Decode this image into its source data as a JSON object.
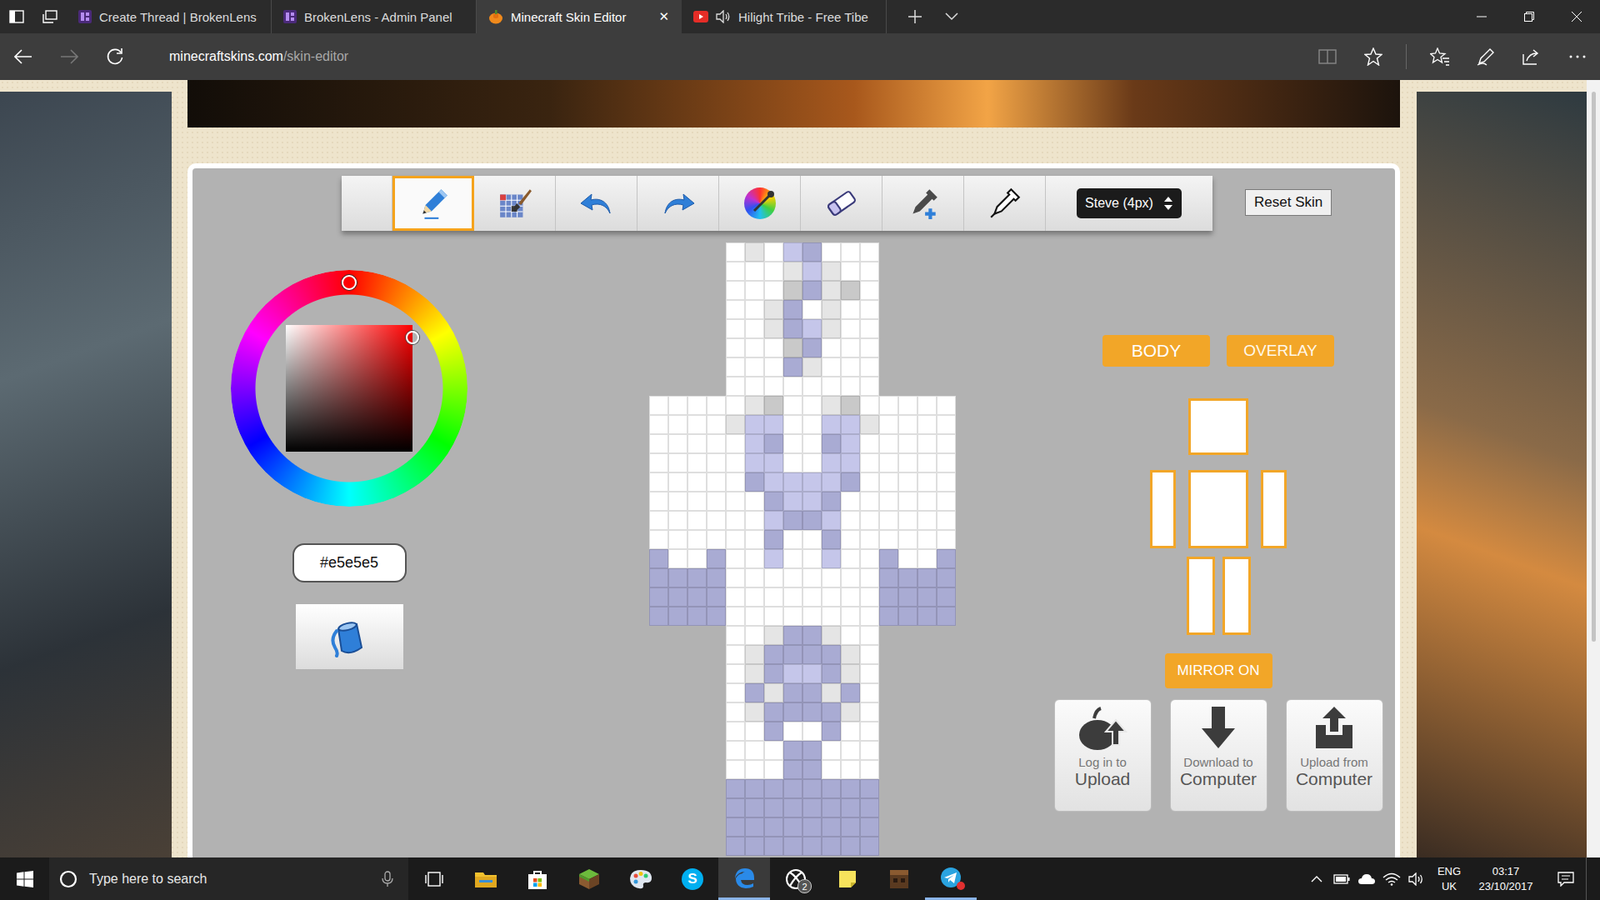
{
  "browser": {
    "tabs": [
      {
        "label": "Create Thread | BrokenLens",
        "selected": false,
        "kind": "brokenlens",
        "audio": false
      },
      {
        "label": "BrokenLens - Admin Panel",
        "selected": false,
        "kind": "brokenlens",
        "audio": false
      },
      {
        "label": "Minecraft Skin Editor",
        "selected": true,
        "kind": "pumpkin",
        "audio": false
      },
      {
        "label": "Hilight Tribe - Free Tibe",
        "selected": false,
        "kind": "youtube",
        "audio": true
      }
    ],
    "close_mark": "✕",
    "forward_enabled": false,
    "address": {
      "host": "minecraftskins.com",
      "path": "/skin-editor"
    }
  },
  "editor": {
    "tools": [
      {
        "kind": "pencil",
        "selected": true
      },
      {
        "kind": "brush",
        "selected": false
      },
      {
        "kind": "undo",
        "selected": false
      },
      {
        "kind": "redo",
        "selected": false
      },
      {
        "kind": "palette",
        "selected": false
      },
      {
        "kind": "eraser",
        "selected": false
      },
      {
        "kind": "dropper-plus",
        "selected": false
      },
      {
        "kind": "dropper",
        "selected": false
      }
    ],
    "model": "Steve (4px)",
    "reset": "Reset Skin",
    "picker": {
      "hue": 0,
      "saturation": 1,
      "brightness": 0.9
    },
    "hex": "#e5e5e5",
    "modes": [
      {
        "label": "BODY",
        "selected": true
      },
      {
        "label": "OVERLAY",
        "selected": false
      }
    ],
    "mirror": "MIRROR ON",
    "actions": [
      {
        "kind": "cloud-upload",
        "lines": [
          "Log in to",
          "Upload"
        ]
      },
      {
        "kind": "download",
        "lines": [
          "Download to",
          "Computer"
        ]
      },
      {
        "kind": "upload",
        "lines": [
          "Upload from",
          "Computer"
        ]
      }
    ],
    "skin": {
      "palette": {
        "w": "#ffffff",
        "l": "#e5e5e5",
        "g": "#c9c9c9",
        "p": "#c5c6ea",
        "b": "#a9abd3"
      },
      "rows": [
        "....wlwpbwww....",
        "....wwwlplww....",
        "....wwwgblgw....",
        "....wwlbwlww....",
        "....wwlbplww....",
        "....wwwgbwww....",
        "....wwwblwww....",
        "....wwwwwwww....",
        "wwwwwlgwwlgwwwww",
        "wwwwlppwwpplwwww",
        "wwwwwpbwwbpwwwww",
        "wwwwwppwwppwwwww",
        "wwwwwbppppbwwwww",
        "wwwwwwbppbwwwwww",
        "wwwwwwpbbpwwwwww",
        "wwwwwwbwwbwwwwww",
        "bwwbwwpwwpwwbwwb",
        "bbbbwwwwwwwwbbbb",
        "bbbbwwwwwwwwbbbb",
        "bbbbwwwwwwwwbbbb",
        "....wwlbblww....",
        "....wlbbbblw....",
        "....wlbppblw....",
        "....wblbblbw....",
        "....wlbbbblw....",
        "....wwbwwbww....",
        "....wwwbbwww....",
        "....wwwbbwww....",
        "....bbbbbbbb....",
        "....bbbbbbbb....",
        "....bbbbbbbb....",
        "....bbbbbbbb...."
      ]
    }
  },
  "taskbar": {
    "search": "Type here to search",
    "apps": [
      {
        "kind": "explorer",
        "open": false,
        "active": false,
        "alert": false
      },
      {
        "kind": "store",
        "open": false,
        "active": false,
        "alert": false
      },
      {
        "kind": "minecraft",
        "open": false,
        "active": false,
        "alert": false
      },
      {
        "kind": "paint",
        "open": false,
        "active": false,
        "alert": false
      },
      {
        "kind": "skype",
        "mark": "S",
        "open": false,
        "active": false,
        "alert": false
      },
      {
        "kind": "edge",
        "open": true,
        "active": true,
        "alert": false
      },
      {
        "kind": "xbox",
        "badge": "2",
        "open": false,
        "active": false,
        "alert": false
      },
      {
        "kind": "sticky",
        "open": false,
        "active": false,
        "alert": false
      },
      {
        "kind": "minecraft-dark",
        "open": false,
        "active": false,
        "alert": false
      },
      {
        "kind": "telegram",
        "open": true,
        "active": false,
        "alert": true
      }
    ],
    "language": "ENG",
    "region": "UK",
    "time": "03:17",
    "date": "23/10/2017"
  }
}
